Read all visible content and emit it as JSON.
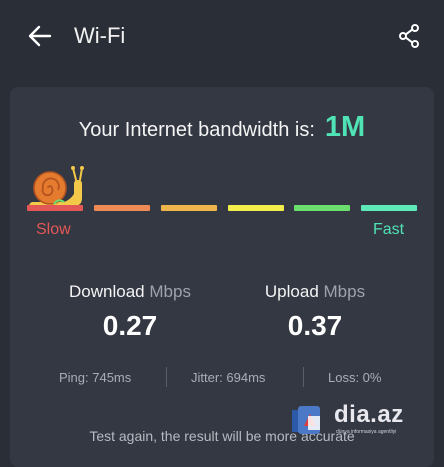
{
  "header": {
    "title": "Wi-Fi",
    "back_icon": "arrow-left-icon",
    "share_icon": "share-icon"
  },
  "bandwidth": {
    "label": "Your Internet bandwidth is:",
    "value": "1M"
  },
  "speed_scale": {
    "slow_label": "Slow",
    "fast_label": "Fast",
    "indicator_icon": "snail-icon",
    "current_segment": 0,
    "segment_colors": [
      "#e45757",
      "#ee8a55",
      "#f0b44c",
      "#f4ee4a",
      "#6cde6e",
      "#5ee9b9"
    ]
  },
  "results": {
    "download": {
      "label": "Download",
      "unit": "Mbps",
      "value": "0.27"
    },
    "upload": {
      "label": "Upload",
      "unit": "Mbps",
      "value": "0.37"
    }
  },
  "stats": {
    "ping": "Ping: 745ms",
    "jitter": "Jitter: 694ms",
    "loss": "Loss: 0%"
  },
  "footer": {
    "retest_text": "Test again, the result will be more accurate"
  },
  "watermark": {
    "text": "dia.az",
    "subtext": "dünya informasiya agentliyi"
  },
  "colors": {
    "background": "#2a2e37",
    "card": "#343842",
    "accent": "#4fe3b5",
    "slow": "#e45757"
  }
}
